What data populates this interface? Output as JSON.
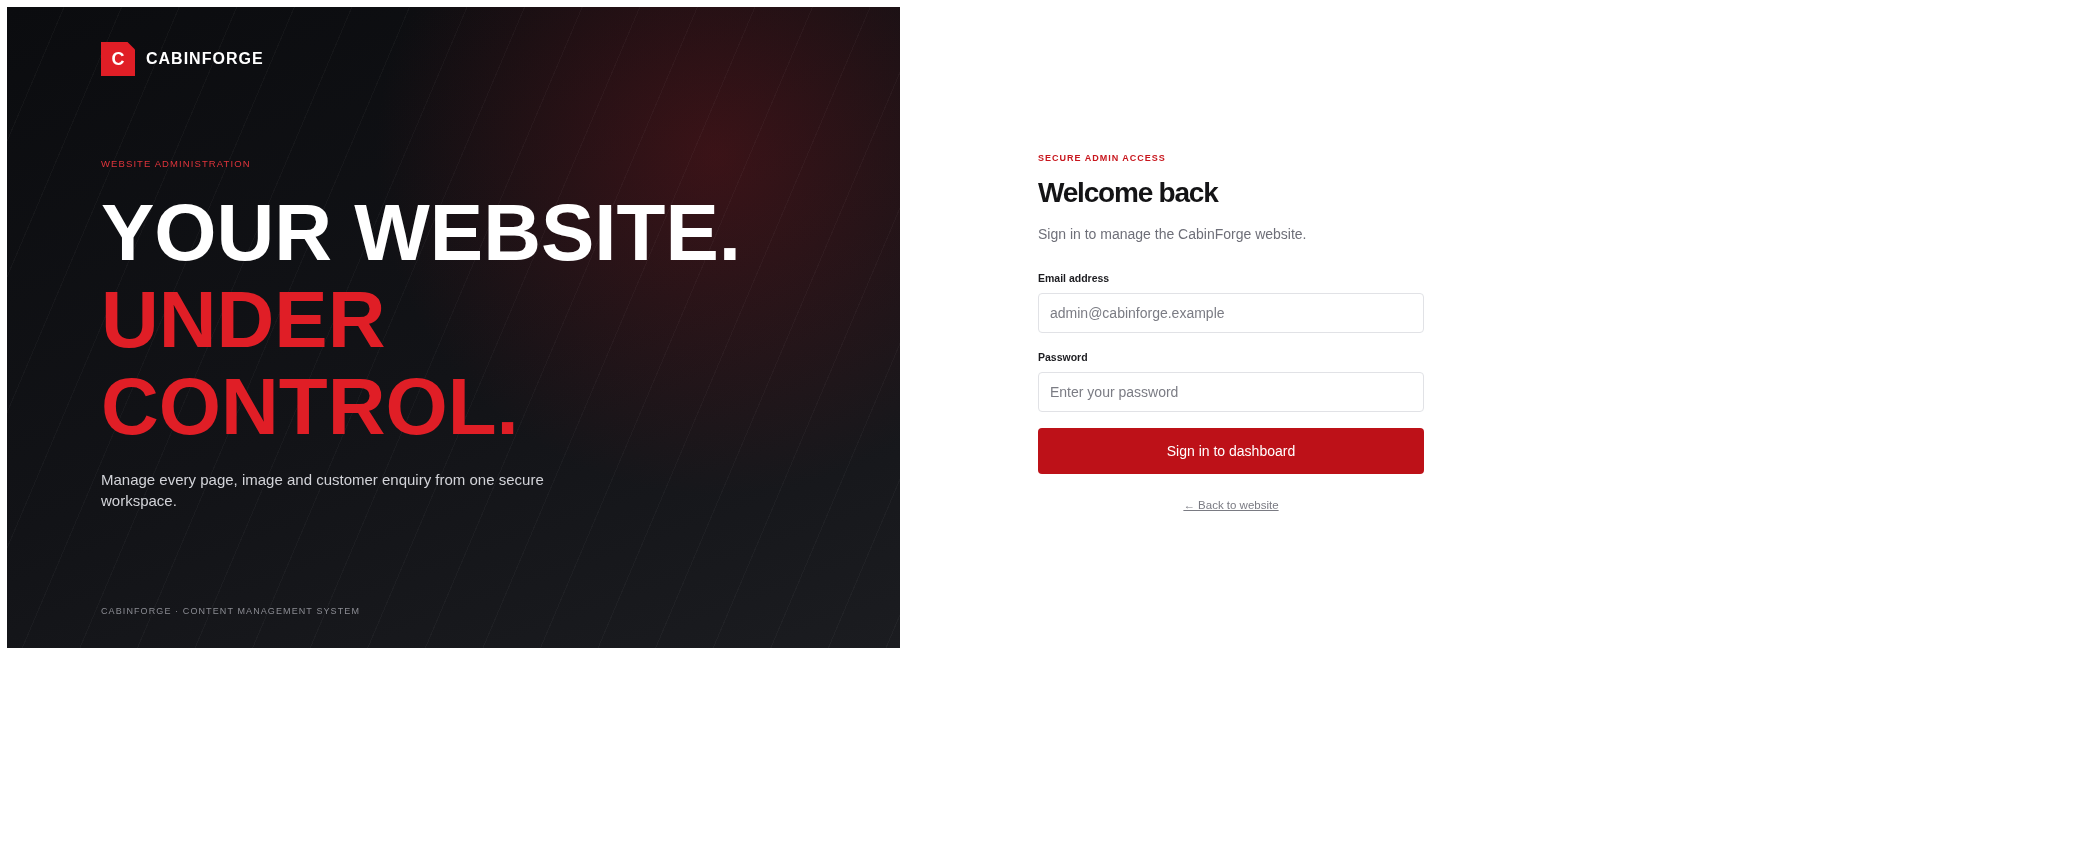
{
  "hero": {
    "brand": {
      "mark": "C",
      "name": "CABINFORGE"
    },
    "eyebrow": "WEBSITE ADMINISTRATION",
    "headline": [
      {
        "text": "YOUR WEBSITE.",
        "kind": "plain"
      },
      {
        "text": "UNDER",
        "kind": "accent"
      },
      {
        "text": "CONTROL.",
        "kind": "accent"
      }
    ],
    "description": "Manage every page, image and customer enquiry from one secure workspace.",
    "footer": "CABINFORGE · CONTENT MANAGEMENT SYSTEM"
  },
  "login": {
    "eyebrow": "SECURE ADMIN ACCESS",
    "title": "Welcome back",
    "subtitle": "Sign in to manage the CabinForge website.",
    "fields": [
      {
        "label": "Email address",
        "placeholder": "admin@cabinforge.example"
      },
      {
        "label": "Password",
        "placeholder": "Enter your password"
      }
    ],
    "submit": "Sign in to dashboard",
    "back_link": "← Back to website"
  }
}
